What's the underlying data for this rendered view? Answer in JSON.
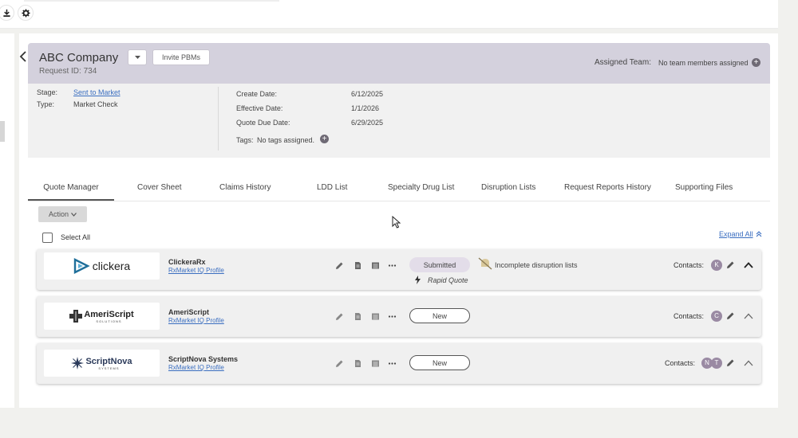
{
  "header": {
    "company": "ABC Company",
    "request_id": "Request ID: 734",
    "invite_label": "Invite PBMs",
    "assigned_label": "Assigned Team:",
    "assigned_value": "No team members assigned"
  },
  "info": {
    "stage_label": "Stage:",
    "stage_value": "Sent to Market",
    "type_label": "Type:",
    "type_value": "Market Check",
    "create_label": "Create Date:",
    "create_value": "6/12/2025",
    "effective_label": "Effective Date:",
    "effective_value": "1/1/2026",
    "due_label": "Quote Due Date:",
    "due_value": "6/29/2025",
    "tags_label": "Tags:",
    "tags_value": "No tags assigned."
  },
  "tabs": [
    {
      "label": "Quote Manager"
    },
    {
      "label": "Cover Sheet"
    },
    {
      "label": "Claims History"
    },
    {
      "label": "LDD List"
    },
    {
      "label": "Specialty Drug List"
    },
    {
      "label": "Disruption Lists"
    },
    {
      "label": "Request Reports History"
    },
    {
      "label": "Supporting Files"
    }
  ],
  "toolbar": {
    "action_label": "Action",
    "select_all": "Select All",
    "expand_all": "Expand All"
  },
  "pbms": [
    {
      "logo": "clickera",
      "name": "ClickeraRx",
      "profile_link": "RxMarket IQ Profile",
      "status": "Submitted",
      "warning": "Incomplete disruption lists",
      "rapid": "Rapid Quote",
      "contacts_label": "Contacts:",
      "avatars": [
        "K"
      ]
    },
    {
      "logo": "AmeriScript",
      "logo_sub": "SOLUTIONS",
      "name": "AmeriScript",
      "profile_link": "RxMarket IQ Profile",
      "status": "New",
      "contacts_label": "Contacts:",
      "avatars": [
        "C"
      ]
    },
    {
      "logo": "ScriptNova",
      "logo_sub": "SYSTEMS",
      "name": "ScriptNova Systems",
      "profile_link": "RxMarket IQ Profile",
      "status": "New",
      "contacts_label": "Contacts:",
      "avatars": [
        "N",
        "T"
      ]
    }
  ],
  "icons": {
    "top_left": [
      "download-icon",
      "gear-icon"
    ],
    "row_actions": [
      "pencil-icon",
      "document-icon",
      "list-icon",
      "more-icon"
    ]
  },
  "colors": {
    "header_band": "#d4d1dd",
    "link": "#3a6ec0",
    "submitted_pill": "#e3dde9",
    "avatar": "#9a8aa3"
  }
}
